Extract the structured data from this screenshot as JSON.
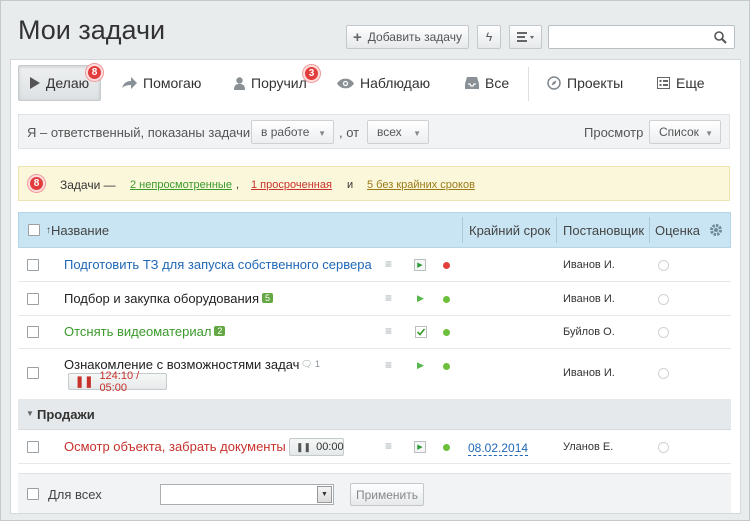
{
  "page": {
    "title": "Мои задачи"
  },
  "toolbar": {
    "add_task_label": "Добавить задачу",
    "add_icon": "plus-icon",
    "quick_icon": "lightning-icon",
    "view_icon": "list-lines-icon",
    "search_placeholder": "",
    "search_icon": "magnifier-icon"
  },
  "tabs": [
    {
      "label": "Делаю",
      "badge": "8",
      "icon": "play-icon"
    },
    {
      "label": "Помогаю",
      "badge": "",
      "icon": "arrow-right-icon"
    },
    {
      "label": "Поручил",
      "badge": "3",
      "icon": "person-icon"
    },
    {
      "label": "Наблюдаю",
      "badge": "",
      "icon": "eye-icon"
    },
    {
      "label": "Все",
      "badge": "",
      "icon": "inbox-icon"
    },
    {
      "label": "Проекты",
      "badge": "",
      "icon": "compass-icon"
    },
    {
      "label": "Еще",
      "badge": "",
      "icon": "grid-list-icon"
    }
  ],
  "filter": {
    "text": "Я – ответственный, показаны задачи",
    "status": "в работе",
    "sep": ", от",
    "from": "всех",
    "view_label": "Просмотр",
    "view_value": "Список"
  },
  "notice": {
    "count": "8",
    "prefix": "Задачи —",
    "unviewed": "2 непросмотренные",
    "comma": ",",
    "overdue": "1 просроченная",
    "and": "и",
    "no_deadline": "5 без крайних сроков"
  },
  "columns": {
    "name": "Название",
    "sort_arrow": "↑",
    "deadline": "Крайний срок",
    "creator": "Постановщик",
    "rating": "Оценка"
  },
  "colors": {
    "red": "#e2403c",
    "green": "#6cbf3a",
    "blue_link": "#2068b7",
    "green_text": "#3a9a2b",
    "red_text": "#c7322c"
  },
  "tasks": [
    {
      "name": "Подготовить ТЗ для запуска собственного сервера",
      "color": "blue",
      "status_dot": "red",
      "creator": "Иванов И.",
      "deadline": "",
      "subcount": ""
    },
    {
      "name": "Подбор и закупка оборудования",
      "color": "black",
      "status_dot": "green",
      "creator": "Иванов И.",
      "deadline": "",
      "subcount": "5"
    },
    {
      "name": "Отснять видеоматериал",
      "color": "green",
      "status_dot": "green",
      "creator": "Буйлов О.",
      "deadline": "",
      "subcount": "2"
    },
    {
      "name": "Ознакомление с возможностями задач",
      "color": "black",
      "status_dot": "green",
      "creator": "Иванов И.",
      "deadline": "",
      "comments": "1",
      "timer": "124:10 / 05:00"
    }
  ],
  "group": {
    "label": "Продажи"
  },
  "group_tasks": [
    {
      "name": "Осмотр объекта, забрать документы",
      "color": "red",
      "status_dot": "green",
      "creator": "Уланов Е.",
      "deadline": "08.02.2014",
      "timer": "00:00"
    }
  ],
  "footer": {
    "for_all": "Для всех",
    "select_value": "",
    "apply": "Применить"
  }
}
